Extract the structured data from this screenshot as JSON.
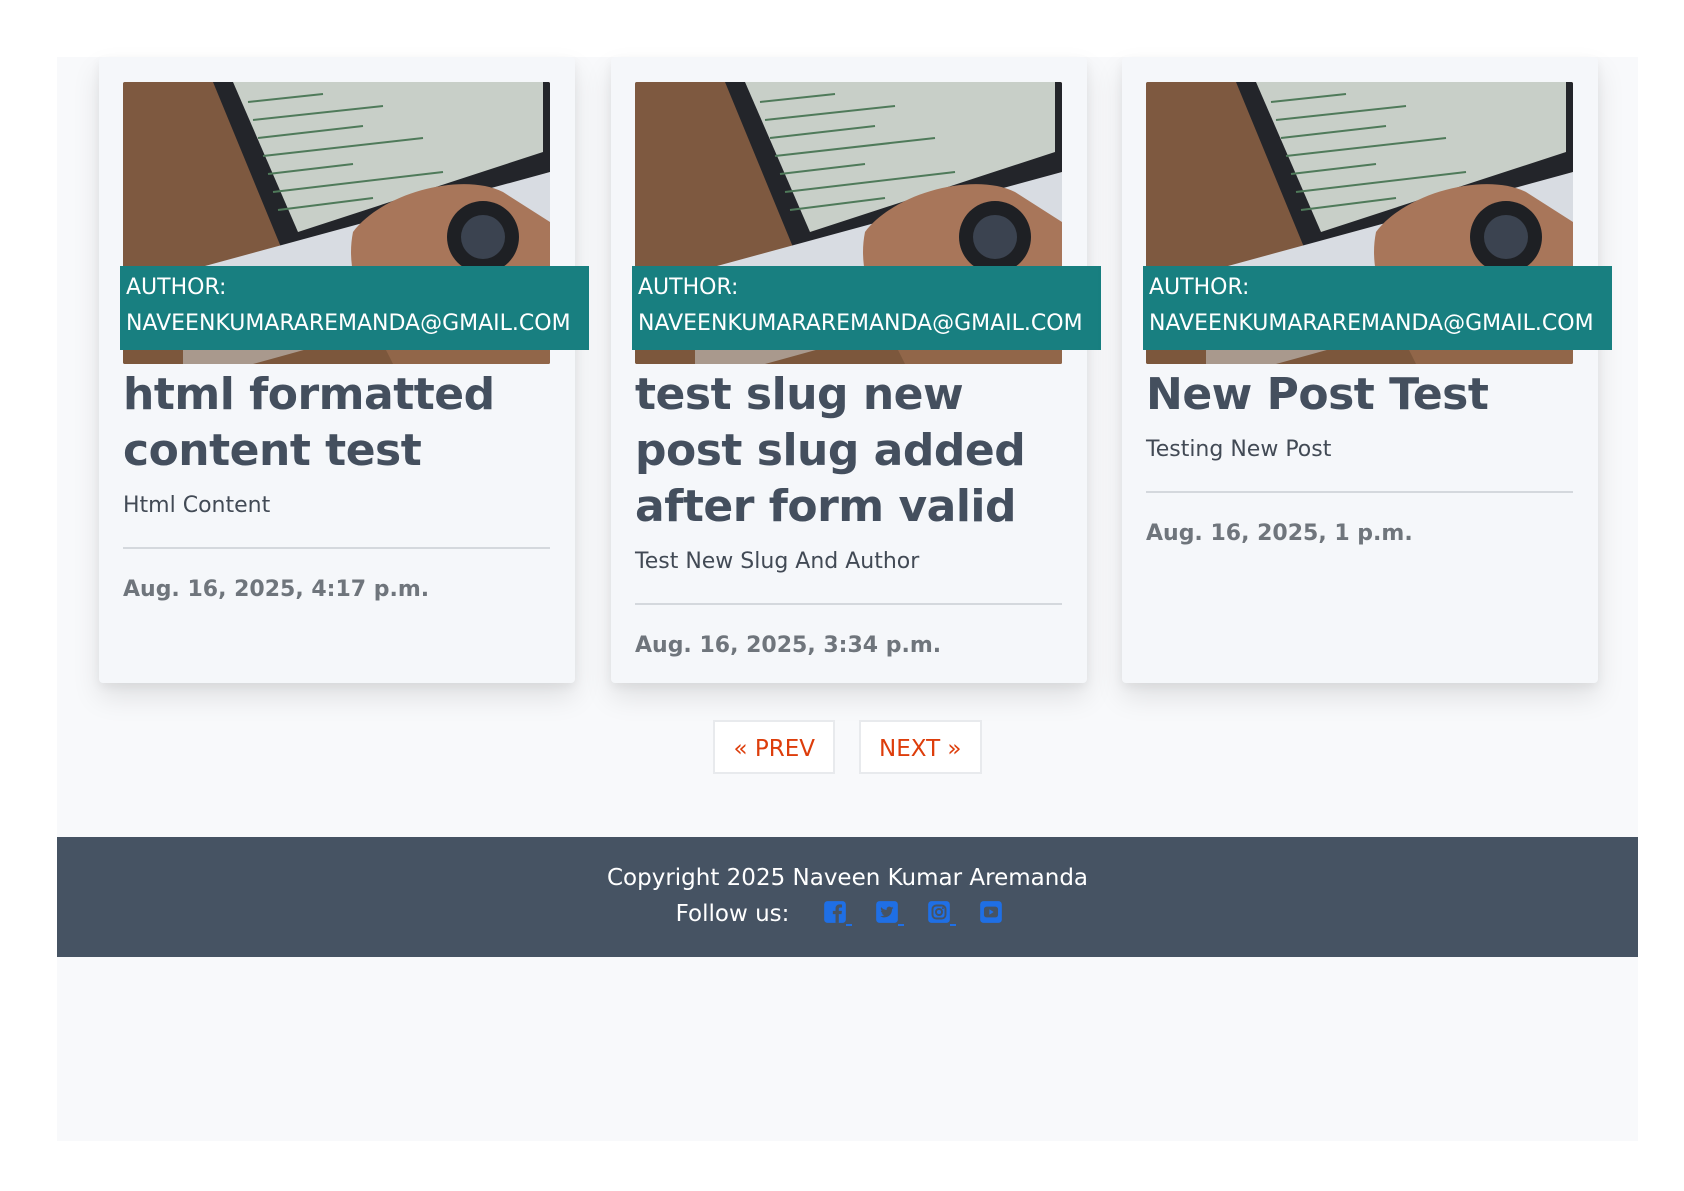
{
  "posts": [
    {
      "author_label": "AUTHOR:",
      "author_email": "NAVEENKUMARAREMANDA@GMAIL.COM",
      "title": "html formatted content test",
      "subtitle": "Html Content",
      "date": "Aug. 16, 2025, 4:17 p.m."
    },
    {
      "author_label": "AUTHOR:",
      "author_email": "NAVEENKUMARAREMANDA@GMAIL.COM",
      "title": "test slug new post slug added after form valid",
      "subtitle": "Test New Slug And Author",
      "date": "Aug. 16, 2025, 3:34 p.m."
    },
    {
      "author_label": "AUTHOR:",
      "author_email": "NAVEENKUMARAREMANDA@GMAIL.COM",
      "title": "New Post Test",
      "subtitle": "Testing New Post",
      "date": "Aug. 16, 2025, 1 p.m."
    }
  ],
  "pagination": {
    "prev_label": "« PREV",
    "next_label": "NEXT »"
  },
  "footer": {
    "copyright": "Copyright 2025 Naveen Kumar Aremanda",
    "follow_label": "Follow us:",
    "social_icons": [
      "facebook-icon",
      "twitter-icon",
      "instagram-icon",
      "youtube-icon"
    ]
  },
  "colors": {
    "author_badge": "#187f80",
    "pagination_text": "#dd3d0b",
    "footer_bg": "#465363",
    "social_icon": "#1f6fe5"
  }
}
